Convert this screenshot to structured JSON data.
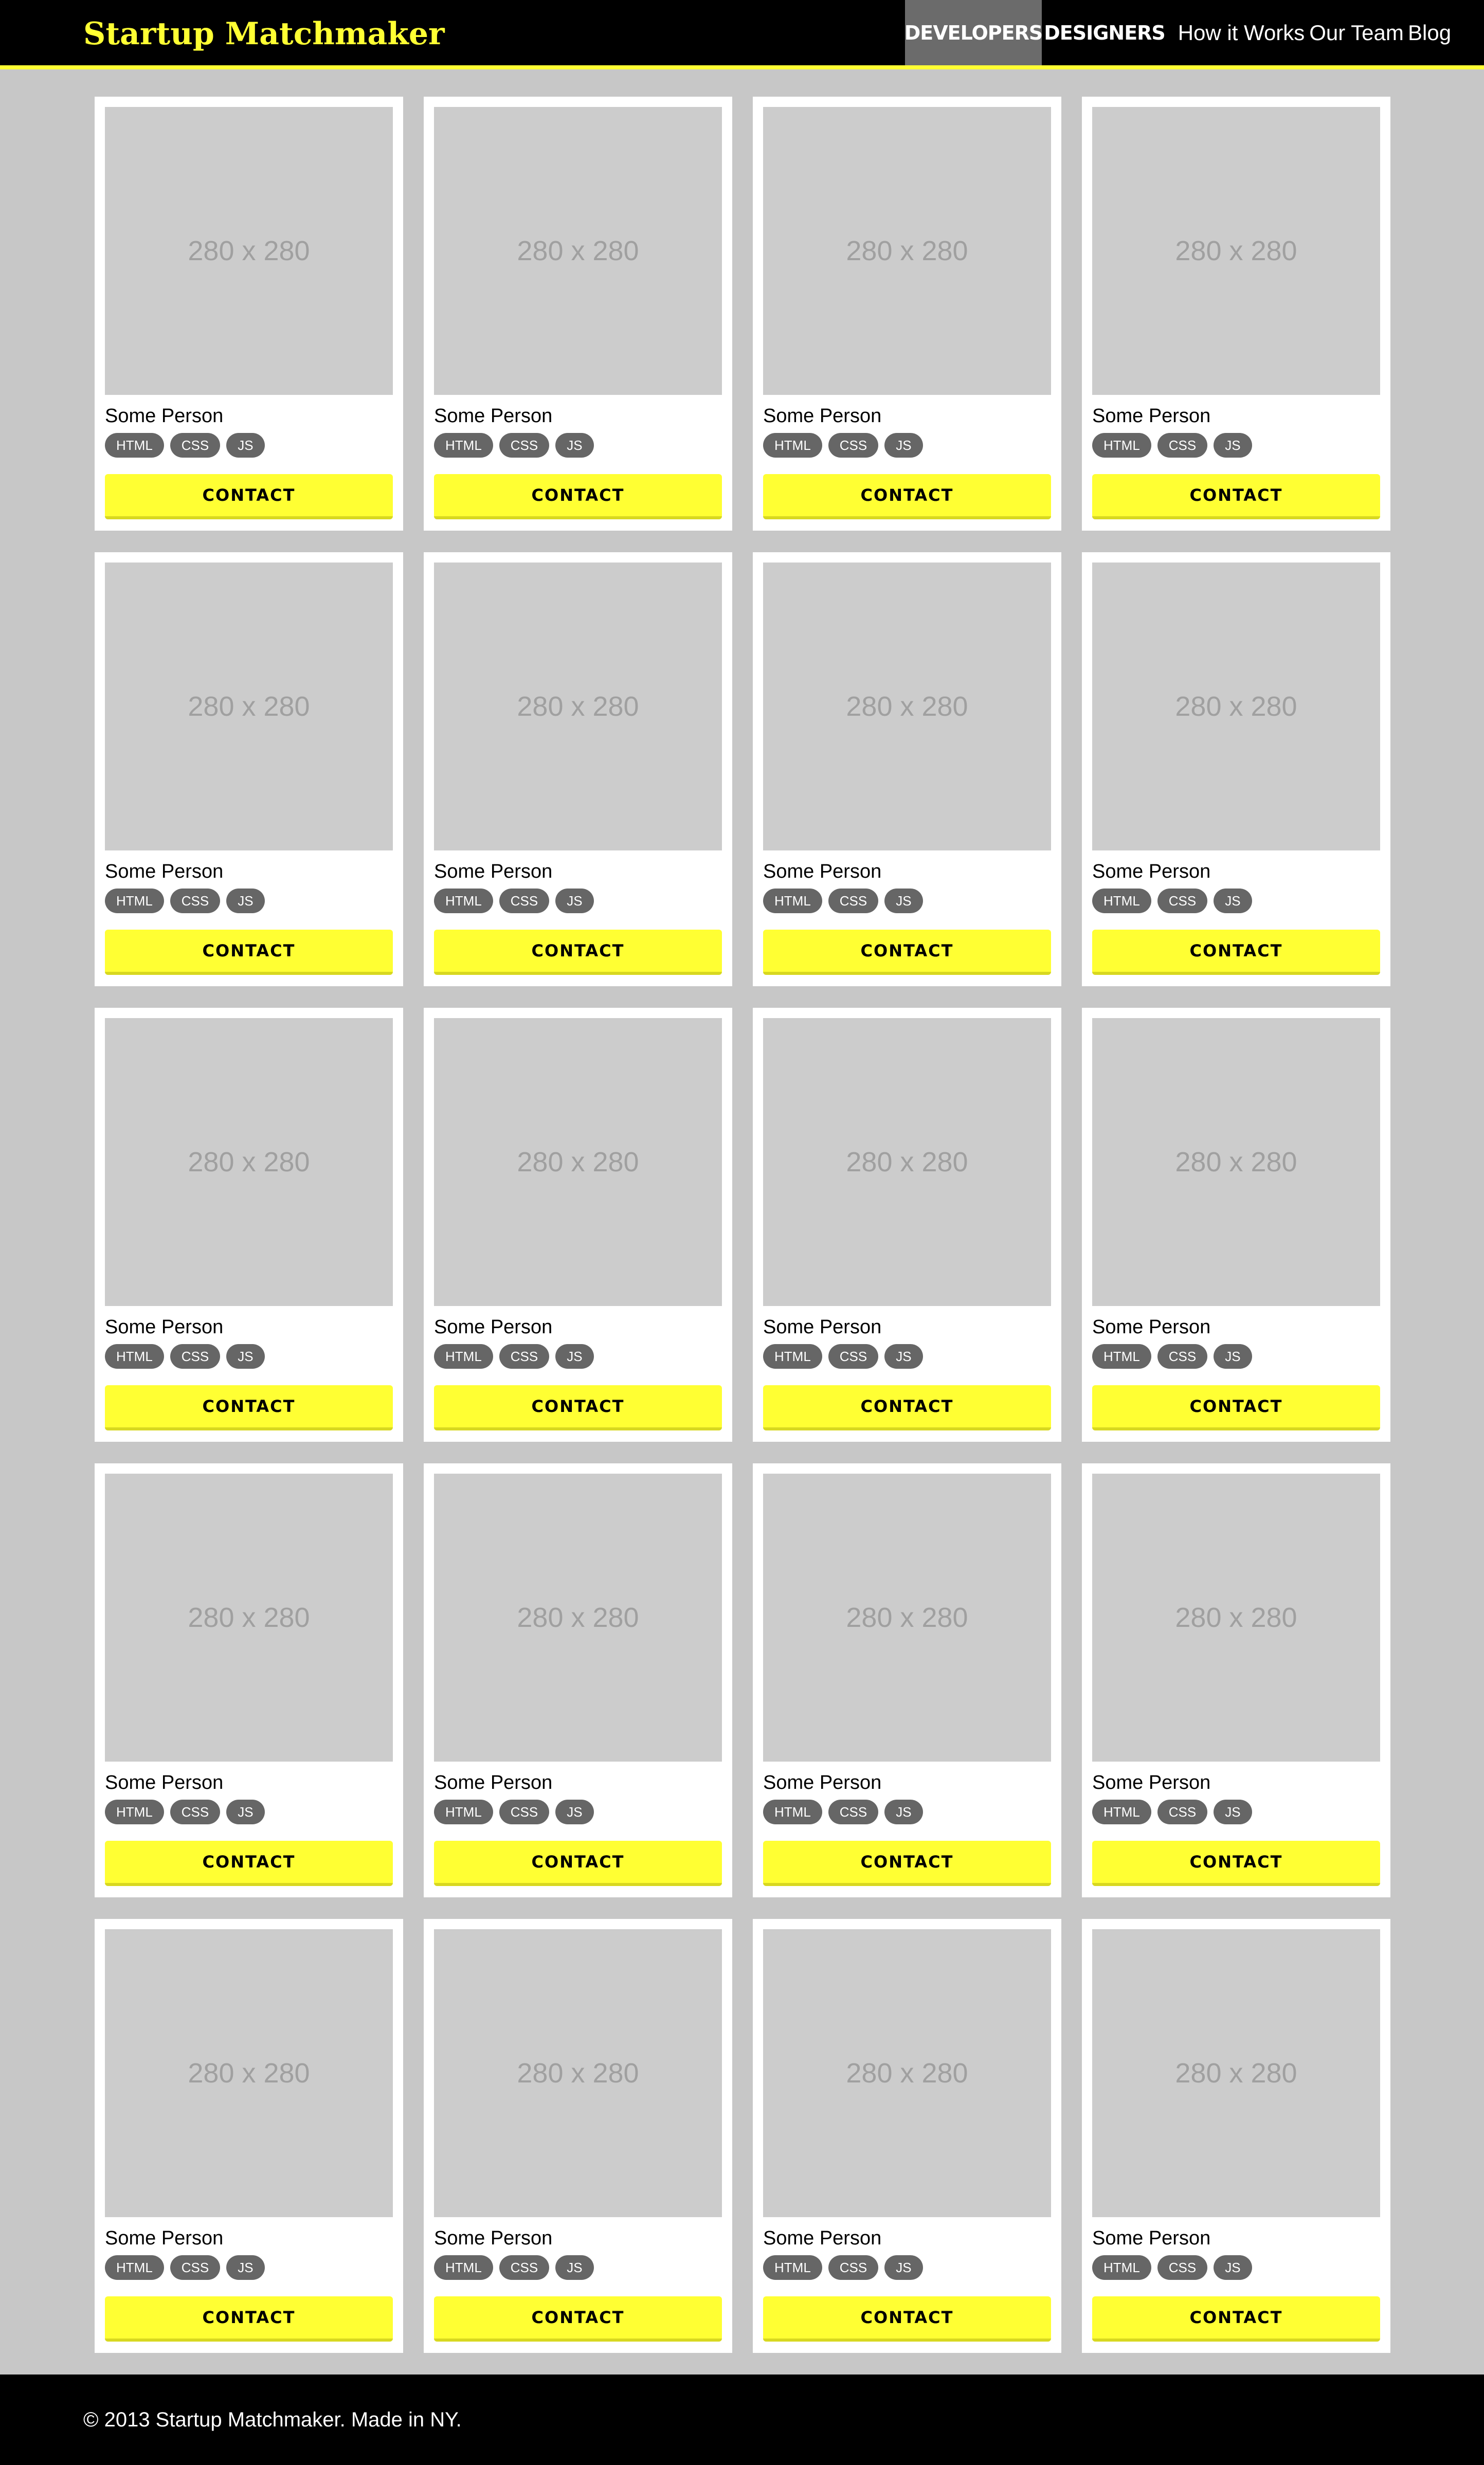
{
  "header": {
    "logo": "Startup Matchmaker",
    "nav": [
      {
        "label": "DEVELOPERS",
        "active": true
      },
      {
        "label": "DESIGNERS",
        "active": false
      },
      {
        "label": "How it Works",
        "active": false
      },
      {
        "label": "Our Team",
        "active": false
      },
      {
        "label": "Blog",
        "active": false
      }
    ]
  },
  "colors": {
    "accent": "#ffff33",
    "header_bg": "#000000",
    "page_bg": "#c7c7c7",
    "placeholder_bg": "#cccccc",
    "tag_bg": "#666666",
    "active_nav_bg": "#6b6b6b"
  },
  "cards": [
    {
      "placeholder": "280 x 280",
      "name": "Some Person",
      "tags": [
        "HTML",
        "CSS",
        "JS"
      ],
      "button": "CONTACT"
    },
    {
      "placeholder": "280 x 280",
      "name": "Some Person",
      "tags": [
        "HTML",
        "CSS",
        "JS"
      ],
      "button": "CONTACT"
    },
    {
      "placeholder": "280 x 280",
      "name": "Some Person",
      "tags": [
        "HTML",
        "CSS",
        "JS"
      ],
      "button": "CONTACT"
    },
    {
      "placeholder": "280 x 280",
      "name": "Some Person",
      "tags": [
        "HTML",
        "CSS",
        "JS"
      ],
      "button": "CONTACT"
    },
    {
      "placeholder": "280 x 280",
      "name": "Some Person",
      "tags": [
        "HTML",
        "CSS",
        "JS"
      ],
      "button": "CONTACT"
    },
    {
      "placeholder": "280 x 280",
      "name": "Some Person",
      "tags": [
        "HTML",
        "CSS",
        "JS"
      ],
      "button": "CONTACT"
    },
    {
      "placeholder": "280 x 280",
      "name": "Some Person",
      "tags": [
        "HTML",
        "CSS",
        "JS"
      ],
      "button": "CONTACT"
    },
    {
      "placeholder": "280 x 280",
      "name": "Some Person",
      "tags": [
        "HTML",
        "CSS",
        "JS"
      ],
      "button": "CONTACT"
    },
    {
      "placeholder": "280 x 280",
      "name": "Some Person",
      "tags": [
        "HTML",
        "CSS",
        "JS"
      ],
      "button": "CONTACT"
    },
    {
      "placeholder": "280 x 280",
      "name": "Some Person",
      "tags": [
        "HTML",
        "CSS",
        "JS"
      ],
      "button": "CONTACT"
    },
    {
      "placeholder": "280 x 280",
      "name": "Some Person",
      "tags": [
        "HTML",
        "CSS",
        "JS"
      ],
      "button": "CONTACT"
    },
    {
      "placeholder": "280 x 280",
      "name": "Some Person",
      "tags": [
        "HTML",
        "CSS",
        "JS"
      ],
      "button": "CONTACT"
    },
    {
      "placeholder": "280 x 280",
      "name": "Some Person",
      "tags": [
        "HTML",
        "CSS",
        "JS"
      ],
      "button": "CONTACT"
    },
    {
      "placeholder": "280 x 280",
      "name": "Some Person",
      "tags": [
        "HTML",
        "CSS",
        "JS"
      ],
      "button": "CONTACT"
    },
    {
      "placeholder": "280 x 280",
      "name": "Some Person",
      "tags": [
        "HTML",
        "CSS",
        "JS"
      ],
      "button": "CONTACT"
    },
    {
      "placeholder": "280 x 280",
      "name": "Some Person",
      "tags": [
        "HTML",
        "CSS",
        "JS"
      ],
      "button": "CONTACT"
    },
    {
      "placeholder": "280 x 280",
      "name": "Some Person",
      "tags": [
        "HTML",
        "CSS",
        "JS"
      ],
      "button": "CONTACT"
    },
    {
      "placeholder": "280 x 280",
      "name": "Some Person",
      "tags": [
        "HTML",
        "CSS",
        "JS"
      ],
      "button": "CONTACT"
    },
    {
      "placeholder": "280 x 280",
      "name": "Some Person",
      "tags": [
        "HTML",
        "CSS",
        "JS"
      ],
      "button": "CONTACT"
    },
    {
      "placeholder": "280 x 280",
      "name": "Some Person",
      "tags": [
        "HTML",
        "CSS",
        "JS"
      ],
      "button": "CONTACT"
    }
  ],
  "footer": {
    "text": "© 2013 Startup Matchmaker. Made in NY."
  }
}
